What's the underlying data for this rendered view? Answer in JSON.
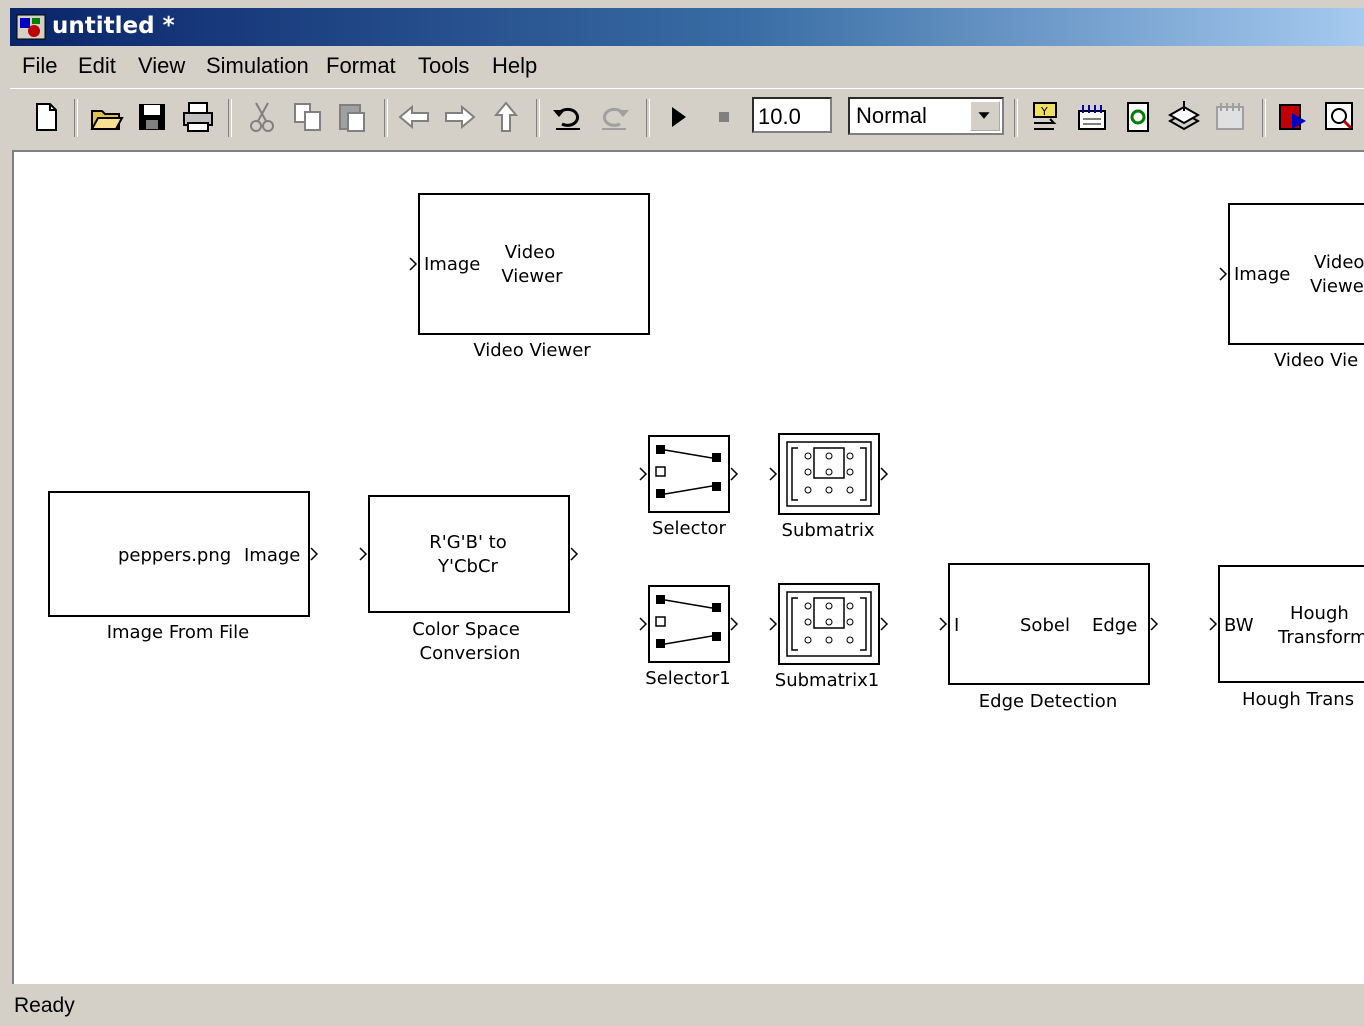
{
  "window": {
    "title": "untitled *"
  },
  "menu": [
    "File",
    "Edit",
    "View",
    "Simulation",
    "Format",
    "Tools",
    "Help"
  ],
  "toolbar": {
    "icons": [
      "new-model-icon",
      "open-icon",
      "save-icon",
      "print-icon",
      "cut-icon",
      "copy-icon",
      "paste-icon",
      "back-icon",
      "forward-icon",
      "up-icon",
      "undo-icon",
      "redo-icon",
      "start-simulation-icon",
      "stop-simulation-icon",
      "build-icon",
      "update-diagram-icon",
      "refresh-icon",
      "library-browser-icon",
      "model-explorer-icon",
      "debug-icon",
      "zoom-icon"
    ],
    "stop_time": "10.0",
    "sim_mode": "Normal"
  },
  "blocks": {
    "video_viewer": {
      "line1": "Video",
      "line2": "Viewer",
      "port": "Image",
      "name": "Video Viewer"
    },
    "video_viewer_2": {
      "line1": "Video",
      "line2": "Viewe",
      "port": "Image",
      "name": "Video Vie"
    },
    "image_from_file": {
      "text": "peppers.png",
      "port": "Image",
      "name": "Image From File"
    },
    "color_space": {
      "line1": "R'G'B' to",
      "line2": "Y'CbCr",
      "name_line1": "Color Space",
      "name_line2": "Conversion"
    },
    "selector": {
      "name": "Selector"
    },
    "selector1": {
      "name": "Selector1"
    },
    "submatrix": {
      "name": "Submatrix"
    },
    "submatrix1": {
      "name": "Submatrix1"
    },
    "edge_detection": {
      "in_port": "I",
      "method": "Sobel",
      "out_port": "Edge",
      "name": "Edge Detection"
    },
    "hough": {
      "in_port": "BW",
      "line1": "Hough",
      "line2": "Transform",
      "name": "Hough Trans"
    }
  },
  "status": "Ready"
}
